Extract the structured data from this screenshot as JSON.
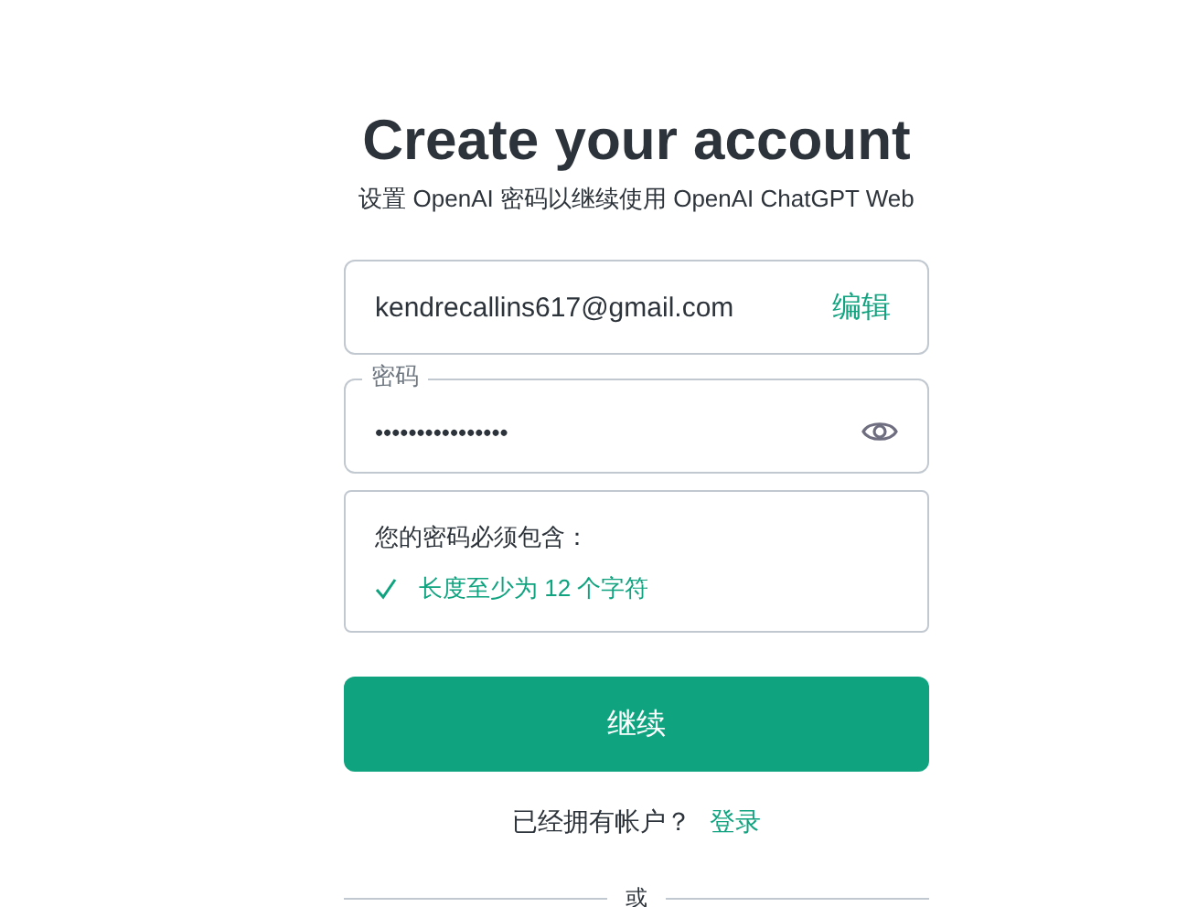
{
  "title": "Create your account",
  "subtitle": "设置 OpenAI 密码以继续使用 OpenAI ChatGPT Web",
  "email": {
    "value": "kendrecallins617@gmail.com",
    "action": "编辑"
  },
  "password": {
    "label": "密码",
    "value": "••••••••••••••••"
  },
  "requirements": {
    "heading": "您的密码必须包含：",
    "items": [
      {
        "text": "长度至少为 12 个字符",
        "met": true
      }
    ]
  },
  "continue_button": "继续",
  "login_prompt": {
    "text": "已经拥有帐户？",
    "link": "登录"
  },
  "divider": "或"
}
